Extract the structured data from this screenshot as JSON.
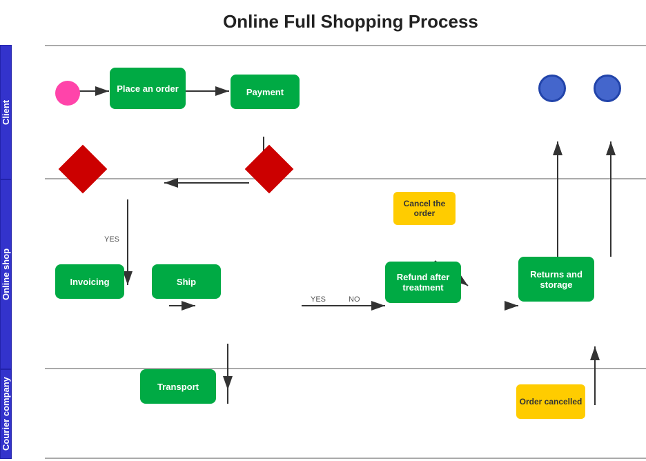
{
  "title": "Online Full Shopping Process",
  "nodes": {
    "place_order": "Place an order",
    "payment": "Payment",
    "invoicing": "Invoicing",
    "ship": "Ship",
    "refund": "Refund after treatment",
    "returns": "Returns and storage",
    "cancel_order": "Cancel the order",
    "transport": "Transport",
    "order_cancelled": "Order cancelled"
  },
  "labels": {
    "yes1": "YES",
    "yes2": "YES",
    "no": "NO",
    "client": "Client",
    "online_shop": "Online shop",
    "courier_company": "Courier company"
  },
  "colors": {
    "green": "#00aa44",
    "yellow": "#ffcc00",
    "red": "#cc0000",
    "blue_circle": "#4466cc",
    "pink_circle": "#ff44aa",
    "lane_bg": "#3333cc",
    "lane_border": "#2244aa"
  }
}
